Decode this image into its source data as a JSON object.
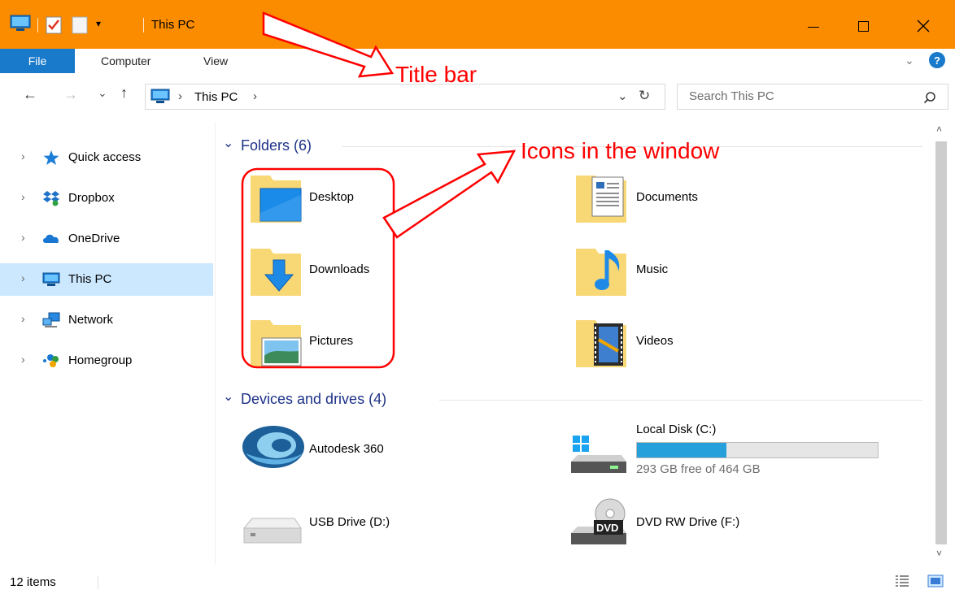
{
  "window": {
    "title": "This PC",
    "controls": {
      "minimize": "—",
      "maximize": "☐",
      "close": "✕"
    }
  },
  "ribbon": {
    "tabs": [
      {
        "label": "File",
        "active": true
      },
      {
        "label": "Computer"
      },
      {
        "label": "View"
      }
    ]
  },
  "address": {
    "path": [
      "This PC"
    ],
    "separator": "›"
  },
  "search": {
    "placeholder": "Search This PC"
  },
  "nav": {
    "items": [
      {
        "label": "Quick access",
        "icon": "star-icon"
      },
      {
        "label": "Dropbox",
        "icon": "dropbox-icon"
      },
      {
        "label": "OneDrive",
        "icon": "cloud-icon"
      },
      {
        "label": "This PC",
        "icon": "computer-icon",
        "selected": true
      },
      {
        "label": "Network",
        "icon": "network-icon"
      },
      {
        "label": "Homegroup",
        "icon": "homegroup-icon"
      }
    ]
  },
  "folders": {
    "header": "Folders (6)",
    "items": [
      {
        "label": "Desktop",
        "icon": "desktop-folder-icon"
      },
      {
        "label": "Documents",
        "icon": "documents-folder-icon"
      },
      {
        "label": "Downloads",
        "icon": "downloads-folder-icon"
      },
      {
        "label": "Music",
        "icon": "music-folder-icon"
      },
      {
        "label": "Pictures",
        "icon": "pictures-folder-icon"
      },
      {
        "label": "Videos",
        "icon": "videos-folder-icon"
      }
    ]
  },
  "devices": {
    "header": "Devices and drives (4)",
    "items": [
      {
        "label": "Autodesk 360",
        "icon": "autodesk-icon"
      },
      {
        "label": "Local Disk (C:)",
        "icon": "hard-drive-icon",
        "free_text": "293 GB free of 464 GB",
        "used_fraction": 0.37
      },
      {
        "label": "USB Drive (D:)",
        "icon": "usb-drive-icon"
      },
      {
        "label": "DVD RW Drive (F:)",
        "icon": "dvd-drive-icon",
        "badge": "DVD"
      }
    ]
  },
  "status": {
    "count": "12 items"
  },
  "annotations": {
    "title_bar": "Title bar",
    "icons": "Icons in the window"
  },
  "colors": {
    "titlebar": "#fb8c00",
    "accent": "#1979ca",
    "selected": "#cce8ff",
    "annotation": "#ff0000"
  }
}
